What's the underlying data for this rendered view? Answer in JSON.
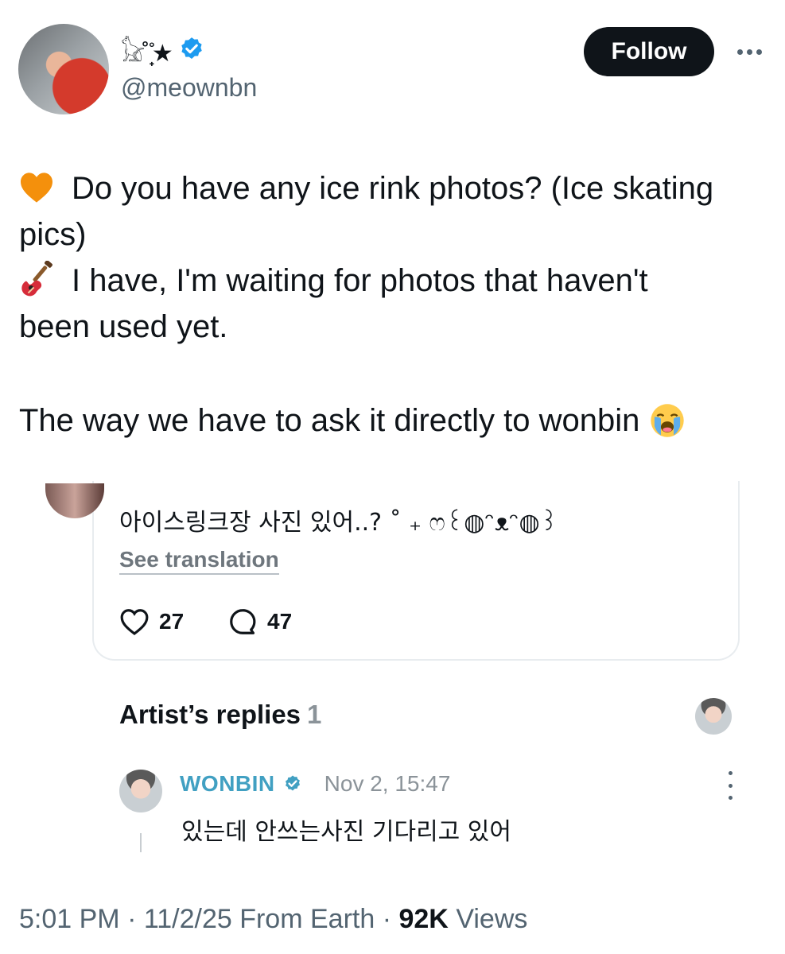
{
  "user": {
    "display_name": "𓃠̊ ̟̊★",
    "handle": "@meownbn",
    "verified": true
  },
  "header": {
    "follow_label": "Follow",
    "more_icon": "more-horizontal-icon"
  },
  "tweet": {
    "line1": "Do you have any ice rink photos? (Ice skating",
    "line2": "pics)",
    "line3": "I have, I'm waiting for photos that haven't",
    "line4": "been used yet.",
    "line5": "The way we have to ask it directly to wonbin",
    "emoji": [
      "orange-heart",
      "guitar",
      "loudly-crying-face"
    ]
  },
  "quoted": {
    "text": "아이스링크장 사진 있어..? ˚ ₊ ෆ꒰◍ᵔᴥᵔ◍꒱",
    "see_translation": "See translation",
    "likes": "27",
    "replies": "47"
  },
  "artist_replies": {
    "title": "Artist’s replies",
    "count": "1",
    "reply": {
      "name": "WONBIN",
      "date": "Nov 2, 15:47",
      "text": "있는데 안쓰는사진 기다리고 있어"
    }
  },
  "footer": {
    "time": "5:01 PM",
    "date": "11/2/25",
    "source": "From Earth",
    "views_count": "92K",
    "views_label": "Views"
  },
  "colors": {
    "verified": "#1d9bf0",
    "artist_name": "#41a0c2",
    "follow_bg": "#0f1419",
    "secondary_text": "#536471"
  }
}
